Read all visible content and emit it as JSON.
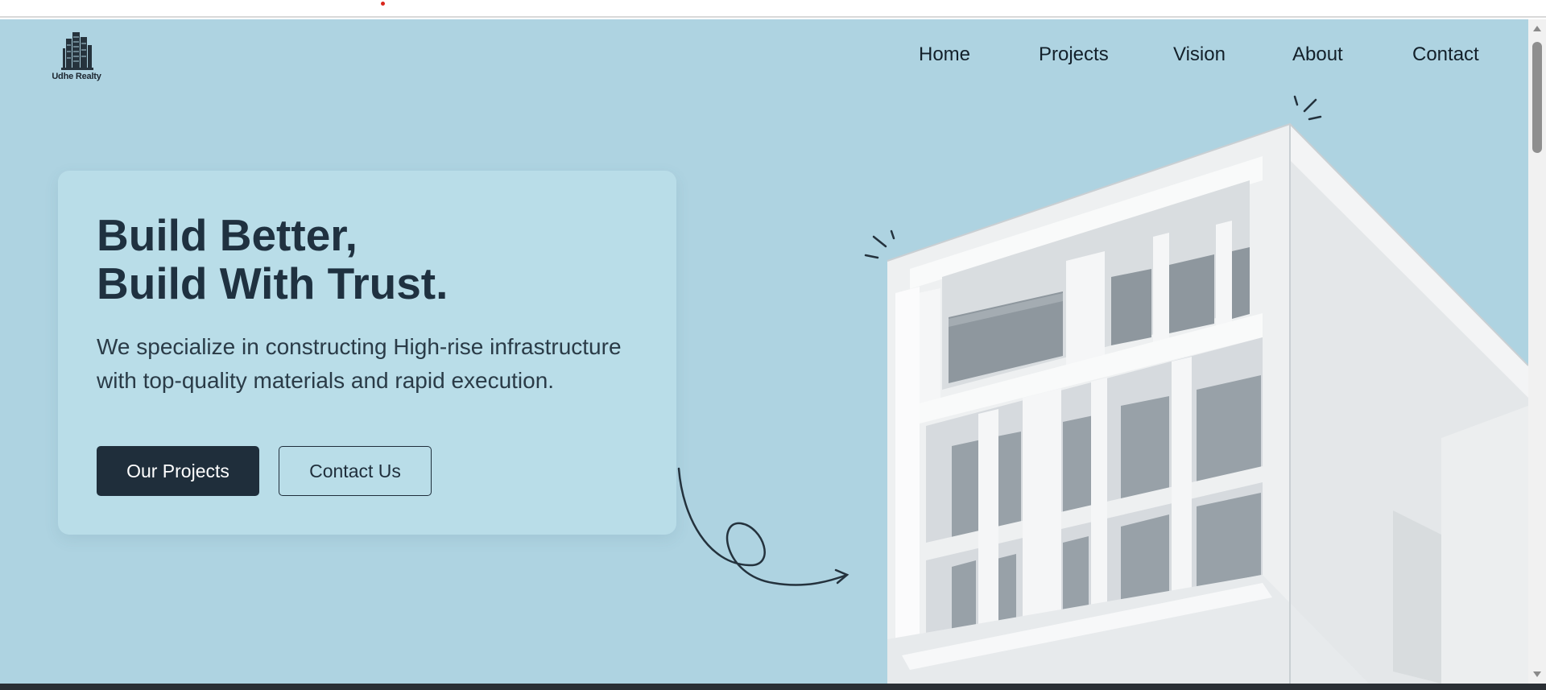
{
  "header": {
    "logo_text": "Udhe Realty",
    "nav": [
      {
        "label": "Home"
      },
      {
        "label": "Projects"
      },
      {
        "label": "Vision"
      },
      {
        "label": "About"
      },
      {
        "label": "Contact"
      }
    ]
  },
  "hero": {
    "title_line1": "Build Better,",
    "title_line2": "Build With Trust.",
    "description": "We specialize in constructing High-rise infrastructure with top-quality materials and rapid execution.",
    "primary_button": "Our Projects",
    "secondary_button": "Contact Us"
  },
  "colors": {
    "background": "#aed3e1",
    "card": "#bee0ea",
    "text_dark": "#1f3140",
    "button_dark": "#1f2e3b"
  },
  "icons": {
    "logo": "building-logo-icon",
    "doodle_arrow": "curly-arrow-icon",
    "sparkles": "sparkle-lines-icon"
  }
}
